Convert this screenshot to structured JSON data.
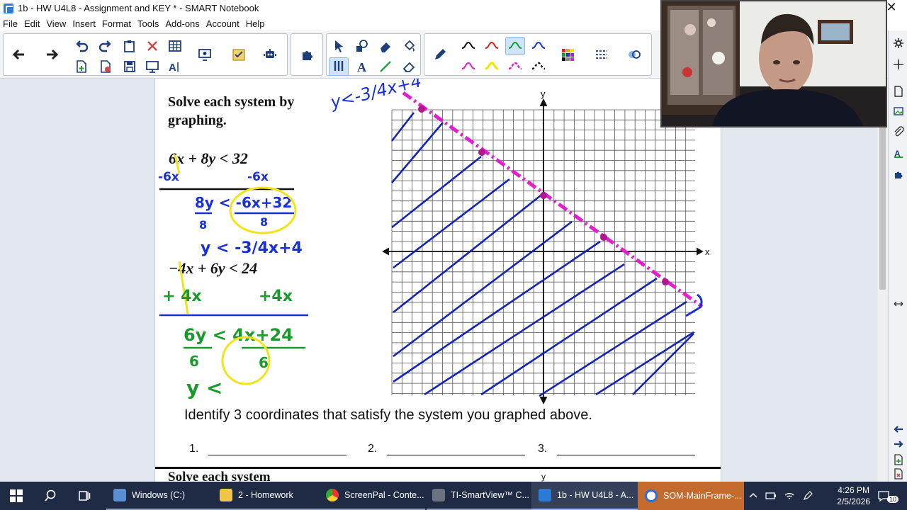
{
  "window": {
    "title": "1b - HW U4L8 - Assignment and KEY * - SMART Notebook"
  },
  "menu": [
    "File",
    "Edit",
    "View",
    "Insert",
    "Format",
    "Tools",
    "Add-ons",
    "Account",
    "Help"
  ],
  "worksheet": {
    "title": "Solve each system by graphing.",
    "equation1": "6x + 8y < 32",
    "equation2": "−4x + 6y < 24",
    "identify_prompt": "Identify 3 coordinates that satisfy the system you graphed above.",
    "answers": [
      "1.",
      "2.",
      "3."
    ],
    "next_title": "Solve each system",
    "axis_x": "x",
    "axis_y": "y",
    "axis_y_next": "y"
  },
  "handwriting": {
    "top_label": "y<-3/4x+4",
    "step1_left": "-6x",
    "step1_right": "-6x",
    "step2": "8y < -6x+32",
    "step2_den": "8",
    "step2_den2": "8",
    "result1": "y < -3/4x+4",
    "step3_left": "+ 4x",
    "step3_right": "+4x",
    "step4": "6y < 4x+24",
    "step4_den": "6",
    "step4_den2": "6",
    "result2": "y <"
  },
  "colors": {
    "boundary_line": "#e11fcf",
    "shading": "#1424b4",
    "ink_blue": "#1830d8",
    "ink_green": "#1a9a2a",
    "highlight_yellow": "#f3e41a"
  },
  "taskbar": {
    "items": [
      "Windows (C:)",
      "2 - Homework",
      "ScreenPal - Conte...",
      "TI-SmartView™ C...",
      "1b - HW U4L8 - A...",
      "SOM-MainFrame-..."
    ],
    "time": "4:26 PM",
    "date": "2/5/2026",
    "notification_count": "10"
  }
}
